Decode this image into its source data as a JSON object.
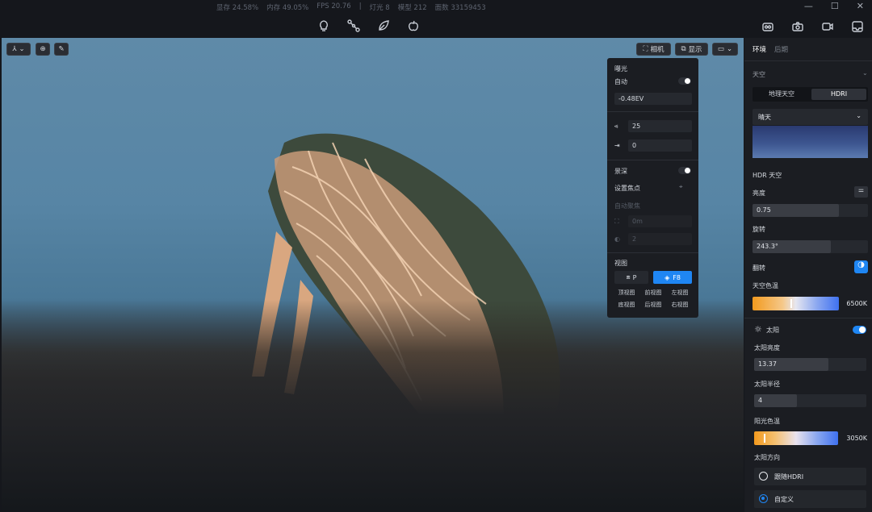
{
  "stats": {
    "vram": "显存 24.58%",
    "mem": "内存 49.05%",
    "fps": "FPS 20.76",
    "divider": "|",
    "lights": "灯光 8",
    "models": "模型 212",
    "faces": "面数 33159453"
  },
  "window_controls": {
    "minimize": "—",
    "maximize": "☐",
    "close": "✕"
  },
  "viewport_toolbar": {
    "camera": "相机",
    "display": "显示"
  },
  "camera_panel": {
    "exposure_title": "曝光",
    "auto_label": "自动",
    "ev_value": "-0.48EV",
    "fov_value": "25",
    "shift_value": "0",
    "dof_title": "景深",
    "focus_label": "设置焦点",
    "autofocus_label": "自动聚焦",
    "focus_distance": "0m",
    "aperture": "2",
    "view_title": "视图",
    "p_label": "P",
    "f8_label": "F8",
    "views": [
      "顶视图",
      "前视图",
      "左视图",
      "底视图",
      "后视图",
      "右视图"
    ]
  },
  "side": {
    "tab_env": "环境",
    "tab_post": "后期",
    "sky_title": "天空",
    "seg_geo": "地理天空",
    "seg_hdri": "HDRI",
    "sky_preset": "晴天",
    "hdr_sky": "HDR 天空",
    "brightness_label": "亮度",
    "brightness_value": "0.75",
    "brightness_fraction": 0.75,
    "rotation_label": "旋转",
    "rotation_value": "243.3°",
    "rotation_fraction": 0.68,
    "flip_label": "翻转",
    "sky_temp_label": "天空色温",
    "sky_temp_value": "6500K",
    "sun_label": "太阳",
    "sun_brightness_label": "太阳亮度",
    "sun_brightness_value": "13.37",
    "sun_brightness_fraction": 0.66,
    "sun_radius_label": "太阳半径",
    "sun_radius_value": "4",
    "sun_radius_fraction": 0.38,
    "sunlight_temp_label": "阳光色温",
    "sunlight_temp_value": "3050K",
    "sun_dir_label": "太阳方向",
    "follow_hdri": "跟随HDRI",
    "custom": "自定义"
  },
  "colors": {
    "accent": "#1f86f3",
    "panel": "#1b1d22",
    "field": "#26292f",
    "background": "#15171c"
  }
}
